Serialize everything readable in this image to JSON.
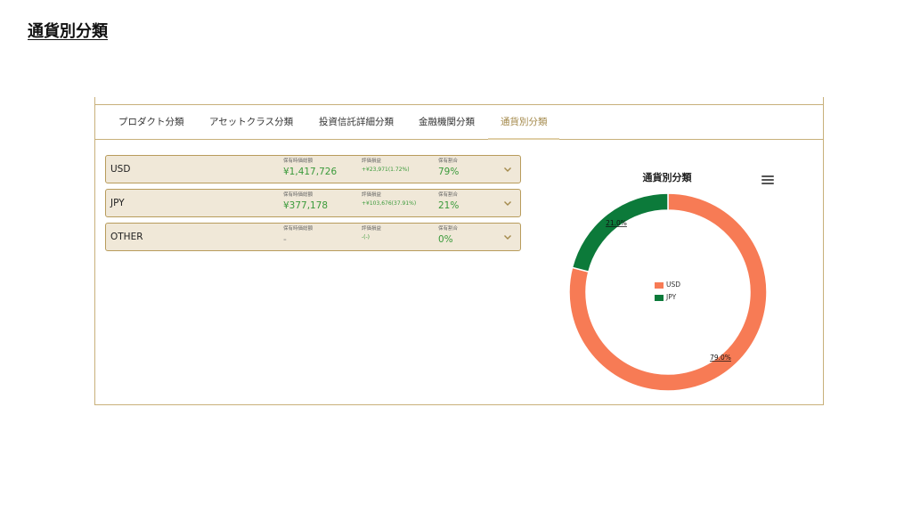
{
  "page": {
    "title": "通貨別分類"
  },
  "colors": {
    "accent": "#b89c5c",
    "row_bg": "#f0e8d8",
    "positive": "#3a9a3a",
    "usd": "#f77b55",
    "jpy": "#0c7a3a"
  },
  "tabs": [
    {
      "label": "プロダクト分類",
      "active": false
    },
    {
      "label": "アセットクラス分類",
      "active": false
    },
    {
      "label": "投資信託詳細分類",
      "active": false
    },
    {
      "label": "金融機関分類",
      "active": false
    },
    {
      "label": "通貨別分類",
      "active": true
    }
  ],
  "rows": [
    {
      "name": "USD",
      "holding_label": "保有時価総額",
      "holding_value": "¥1,417,726",
      "pl_label": "評価損益",
      "pl_value": "+¥23,971(1.72%)",
      "ratio_label": "保有割合",
      "ratio_value": "79%"
    },
    {
      "name": "JPY",
      "holding_label": "保有時価総額",
      "holding_value": "¥377,178",
      "pl_label": "評価損益",
      "pl_value": "+¥103,676(37.91%)",
      "ratio_label": "保有割合",
      "ratio_value": "21%"
    },
    {
      "name": "OTHER",
      "holding_label": "保有時価総額",
      "holding_value": "-",
      "pl_label": "評価損益",
      "pl_value": "-(-)",
      "ratio_label": "保有割合",
      "ratio_value": "0%"
    }
  ],
  "icons": {
    "expand": "chevron-down-icon",
    "menu": "hamburger-menu-icon"
  },
  "chart_data": {
    "type": "pie",
    "title": "通貨別分類",
    "donut": true,
    "categories": [
      "USD",
      "JPY"
    ],
    "values": [
      79.0,
      21.0
    ],
    "data_labels": [
      "79.0%",
      "21.0%"
    ],
    "colors": [
      "#f77b55",
      "#0c7a3a"
    ],
    "legend": [
      "USD",
      "JPY"
    ],
    "legend_position": "center"
  }
}
